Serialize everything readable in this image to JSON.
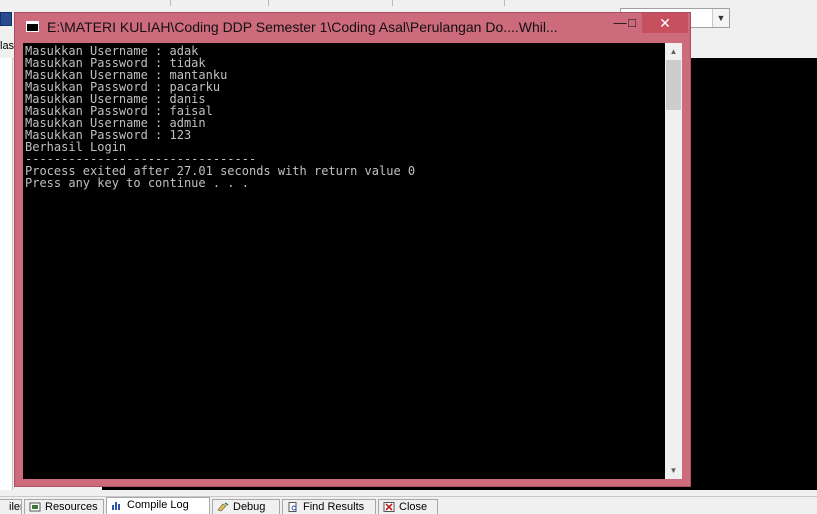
{
  "console_window": {
    "title": "E:\\MATERI KULIAH\\Coding DDP Semester 1\\Coding Asal\\Perulangan Do....Whil...",
    "minimize": "▭",
    "maximize": "□",
    "close": "✕",
    "lines": [
      "Masukkan Username : adak",
      "Masukkan Password : tidak",
      "Masukkan Username : mantanku",
      "Masukkan Password : pacarku",
      "Masukkan Username : danis",
      "Masukkan Password : faisal",
      "Masukkan Username : admin",
      "Masukkan Password : 123",
      "Berhasil Login",
      "--------------------------------",
      "Process exited after 27.01 seconds with return value 0",
      "Press any key to continue . . ."
    ]
  },
  "ide": {
    "left_label": "las",
    "bottom_tabs": [
      {
        "label": "iler",
        "icon": "compiler-icon"
      },
      {
        "label": "Resources",
        "icon": "resources-icon"
      },
      {
        "label": "Compile Log",
        "icon": "compile-log-icon"
      },
      {
        "label": "Debug",
        "icon": "debug-icon"
      },
      {
        "label": "Find Results",
        "icon": "find-icon"
      },
      {
        "label": "Close",
        "icon": "close-icon"
      }
    ]
  },
  "colors": {
    "title_bar": "#cd6a7c",
    "close_button": "#c7505e",
    "console_bg": "#000000",
    "console_text": "#c0c0c0"
  }
}
